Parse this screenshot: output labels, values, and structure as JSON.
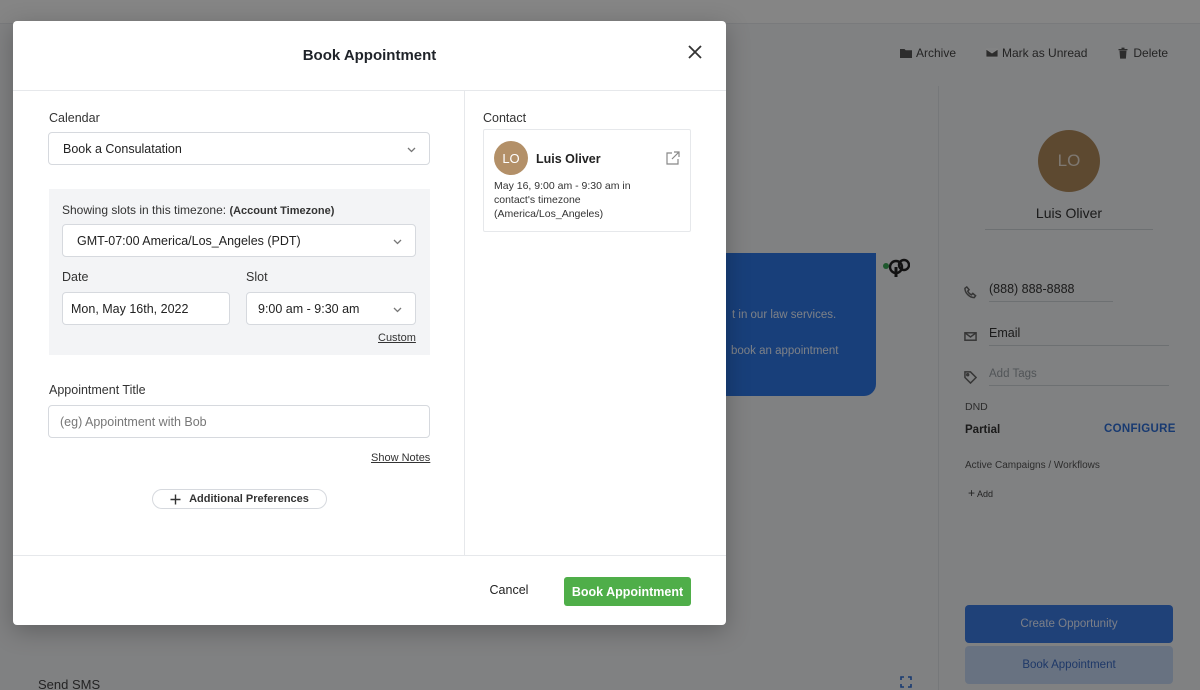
{
  "background": {
    "actions": [
      {
        "label": "Archive",
        "icon": "folder-icon"
      },
      {
        "label": "Mark as Unread",
        "icon": "envelope-icon"
      },
      {
        "label": "Delete",
        "icon": "trash-icon"
      }
    ],
    "bubble": {
      "line1": "t in our law services.",
      "line2": "book an appointment"
    },
    "contact_panel": {
      "avatar_initials": "LO",
      "name": "Luis Oliver",
      "phone": "(888) 888-8888",
      "email_placeholder": "Email",
      "tags_placeholder": "Add Tags",
      "dnd_label": "DND",
      "dnd_value": "Partial",
      "configure_label": "CONFIGURE",
      "campaigns_label": "Active Campaigns / Workflows",
      "add_label": "Add",
      "create_opportunity_label": "Create Opportunity",
      "book_appointment_label": "Book Appointment"
    },
    "send_sms_label": "Send SMS"
  },
  "modal": {
    "title": "Book Appointment",
    "calendar": {
      "label": "Calendar",
      "selected": "Book a Consulatation"
    },
    "timezone": {
      "caption": "Showing slots in this timezone:",
      "caption_bold": "(Account Timezone)",
      "selected": "GMT-07:00 America/Los_Angeles (PDT)"
    },
    "date": {
      "label": "Date",
      "value": "Mon, May 16th, 2022"
    },
    "slot": {
      "label": "Slot",
      "selected": "9:00 am - 9:30 am",
      "custom_link": "Custom"
    },
    "appointment_title": {
      "label": "Appointment Title",
      "placeholder": "(eg) Appointment with Bob",
      "value": ""
    },
    "show_notes_link": "Show Notes",
    "additional_preferences_label": "Additional Preferences",
    "contact": {
      "section_label": "Contact",
      "avatar_initials": "LO",
      "name": "Luis Oliver",
      "info": "May 16, 9:00 am - 9:30 am in contact's timezone (America/Los_Angeles)"
    },
    "footer": {
      "cancel_label": "Cancel",
      "book_label": "Book Appointment"
    }
  },
  "colors": {
    "primary_green": "#4fae49",
    "brand_blue": "#2f77e6",
    "avatar_brown": "#b39068"
  }
}
